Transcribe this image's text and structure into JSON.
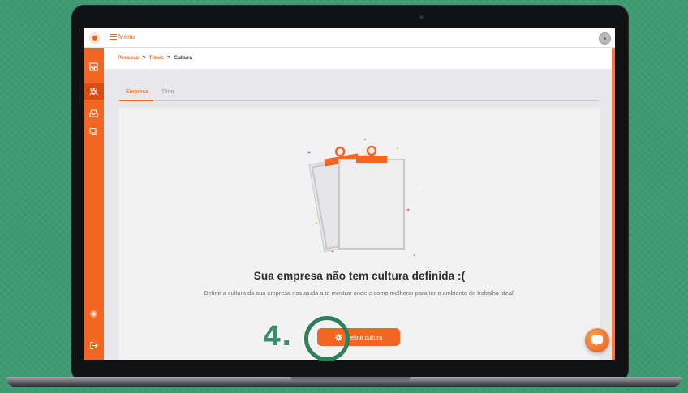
{
  "app": {
    "menu_label": "Menu"
  },
  "breadcrumb": {
    "items": [
      "Pessoas",
      "Times",
      "Cultura"
    ],
    "separator": ">"
  },
  "tabs": [
    {
      "label": "Empresa",
      "active": true
    },
    {
      "label": "Time",
      "active": false
    }
  ],
  "empty_state": {
    "title": "Sua empresa não tem cultura definida :(",
    "description": "Definir a cultura da sua empresa nos ajuda a te mostrar onde e como melhorar para ter o ambiente de trabalho ideal!",
    "cta_label": "Definir cultura",
    "cta_icon": "gear-icon"
  },
  "tutorial": {
    "step_label": "4."
  },
  "sidebar": {
    "icons": [
      "dashboard-icon",
      "people-icon",
      "inbox-icon",
      "feedback-icon",
      "logo-icon",
      "logout-icon"
    ],
    "active_index": 1
  },
  "colors": {
    "brand": "#f26522",
    "background": "#3f9a72",
    "tutorial_accent": "#2f7e5b"
  }
}
